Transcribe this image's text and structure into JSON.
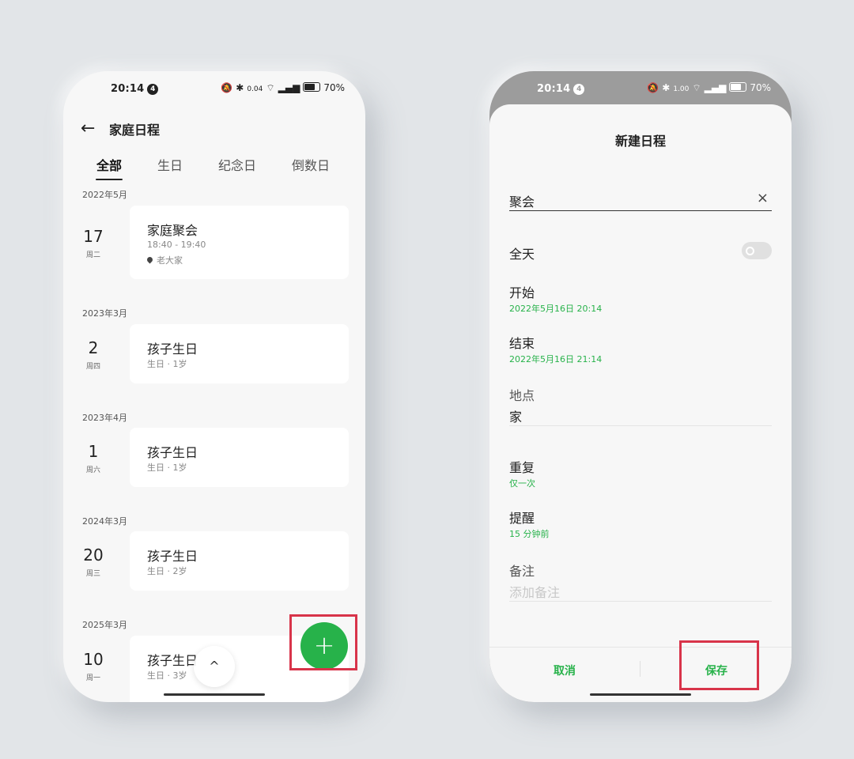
{
  "left": {
    "status": {
      "time": "20:14",
      "notif_count": "4",
      "net_speed": "0.04",
      "battery": "70%"
    },
    "header": {
      "title": "家庭日程"
    },
    "tabs": [
      "全部",
      "生日",
      "纪念日",
      "倒数日"
    ],
    "events": [
      {
        "group": "2022年5月",
        "day": "17",
        "weekday": "周二",
        "title": "家庭聚会",
        "time": "18:40 - 19:40",
        "location": "老大家"
      },
      {
        "group": "2023年3月",
        "day": "2",
        "weekday": "周四",
        "title": "孩子生日",
        "sub": "生日 · 1岁"
      },
      {
        "group": "2023年4月",
        "day": "1",
        "weekday": "周六",
        "title": "孩子生日",
        "sub": "生日 · 1岁"
      },
      {
        "group": "2024年3月",
        "day": "20",
        "weekday": "周三",
        "title": "孩子生日",
        "sub": "生日 · 2岁"
      },
      {
        "group": "2025年3月",
        "day": "10",
        "weekday": "周一",
        "title": "孩子生日",
        "sub": "生日 · 3岁"
      }
    ],
    "fab_label": "+",
    "scroll_up_label": "^"
  },
  "right": {
    "status": {
      "time": "20:14",
      "notif_count": "4",
      "net_speed": "1.00",
      "battery": "70%"
    },
    "sheet_title": "新建日程",
    "name_value": "聚会",
    "clear_label": "×",
    "allday_label": "全天",
    "start_label": "开始",
    "start_value": "2022年5月16日 20:14",
    "end_label": "结束",
    "end_value": "2022年5月16日 21:14",
    "location_label": "地点",
    "location_value": "家",
    "repeat_label": "重复",
    "repeat_value": "仅一次",
    "reminder_label": "提醒",
    "reminder_value": "15 分钟前",
    "notes_label": "备注",
    "notes_placeholder": "添加备注",
    "cancel_label": "取消",
    "save_label": "保存"
  },
  "colors": {
    "accent": "#27b24a",
    "highlight": "#d8344a"
  }
}
